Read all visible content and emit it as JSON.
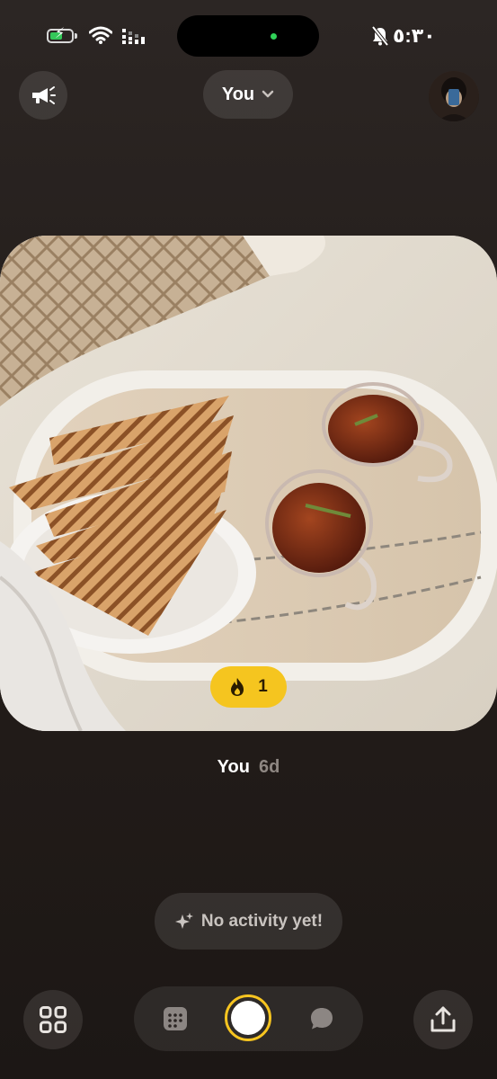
{
  "status_bar": {
    "time": "٥:٣٠",
    "icons": [
      "battery-charging-icon",
      "wifi-icon",
      "cellular-signal-icon",
      "silent-mode-bell-icon"
    ],
    "battery_level": 0.45
  },
  "header": {
    "left_button_icon": "megaphone-icon",
    "selector_label": "You",
    "selector_icon": "chevron-down-icon",
    "profile_icon": "avatar"
  },
  "post": {
    "reaction_icon": "fire-icon",
    "reaction_count": "1",
    "author": "You",
    "age": "6d"
  },
  "activity": {
    "icon": "sparkles-icon",
    "label": "No activity yet!"
  },
  "bottom_bar": {
    "left_icon": "grid-icon",
    "center_icons": [
      "calendar-icon",
      "shutter-button",
      "chat-bubble-icon"
    ],
    "right_icon": "share-icon"
  },
  "colors": {
    "accent_yellow": "#f5c51f",
    "background": "#231d1a",
    "battery_green": "#34c759"
  }
}
